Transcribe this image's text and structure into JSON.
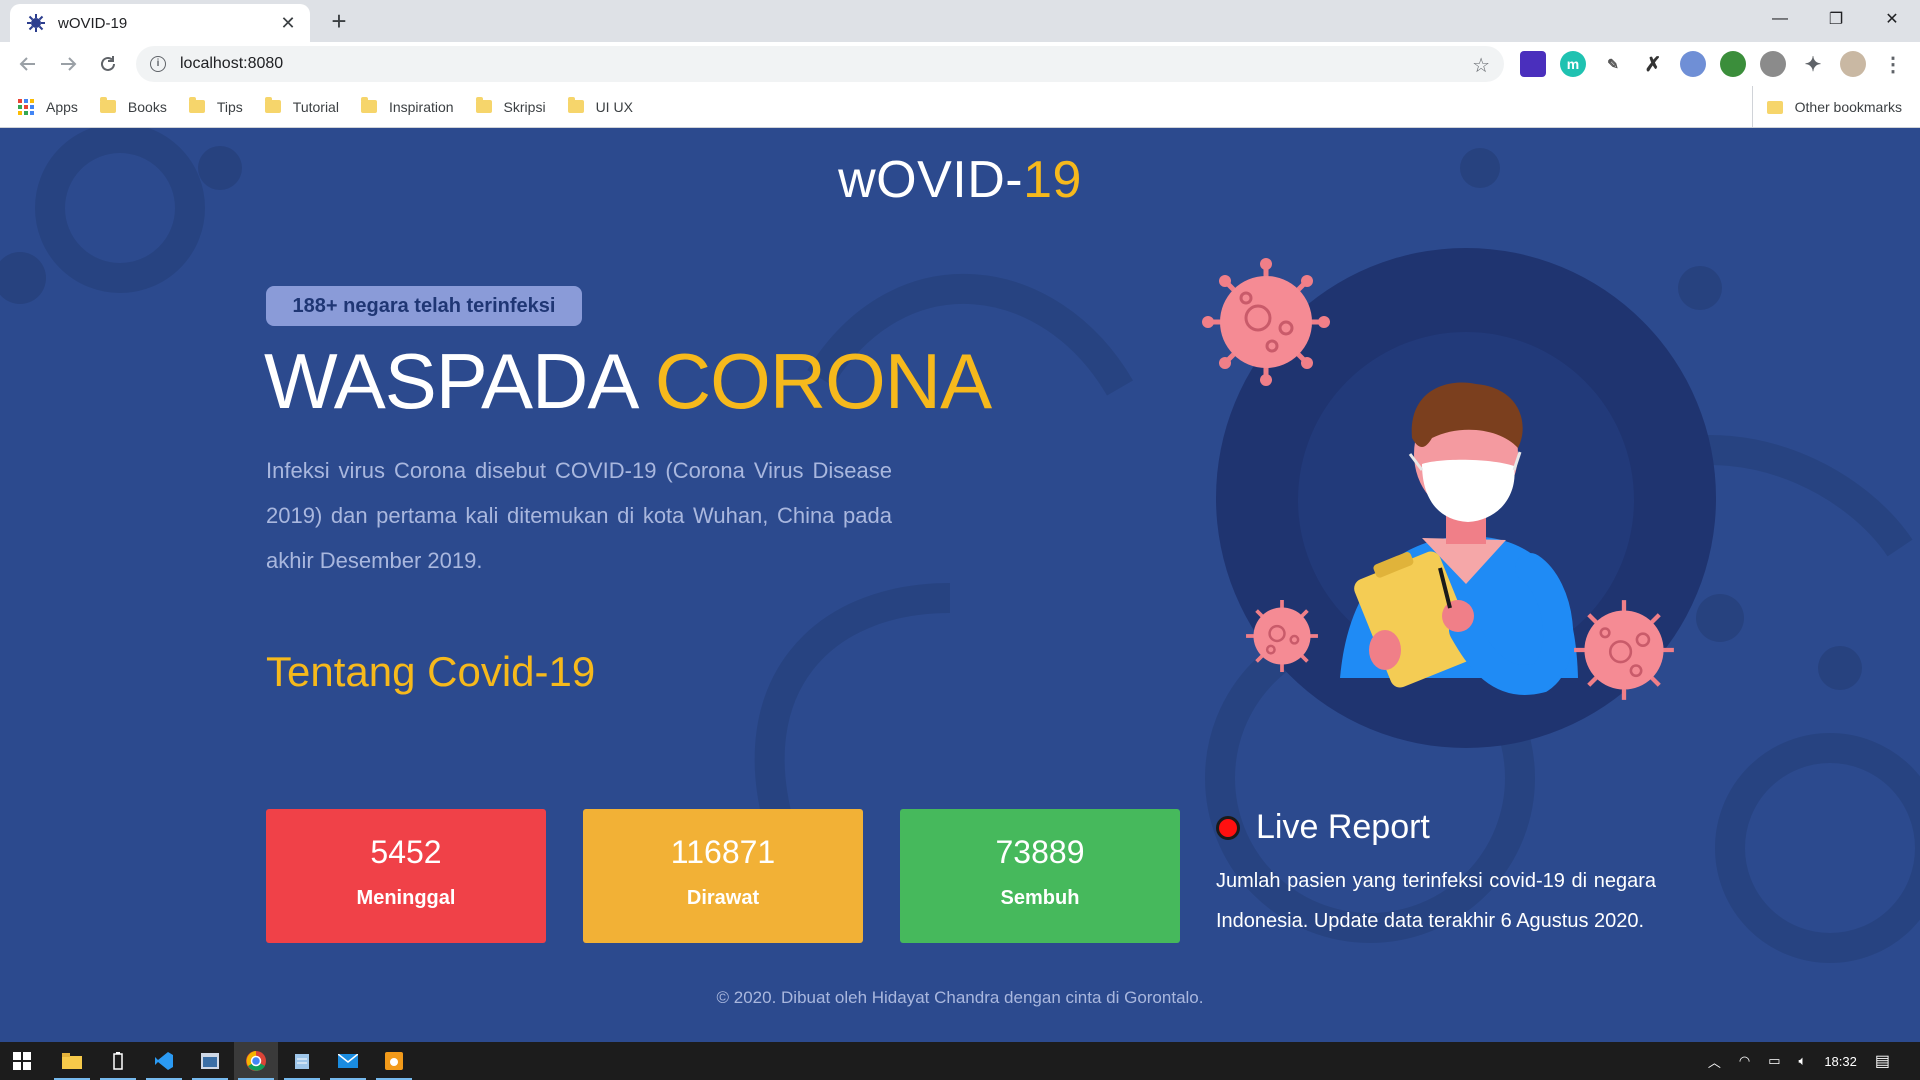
{
  "browser": {
    "tab_title": "wOVID-19",
    "tab_close": "✕",
    "new_tab": "+",
    "url": "localhost:8080",
    "window_controls": {
      "minimize": "—",
      "maximize": "❐",
      "close": "✕"
    }
  },
  "bookmarks": {
    "apps": "Apps",
    "items": [
      "Books",
      "Tips",
      "Tutorial",
      "Inspiration",
      "Skripsi",
      "UI UX"
    ],
    "other": "Other bookmarks"
  },
  "page": {
    "brand_main": "wOVID-",
    "brand_accent": "19",
    "badge": "188+ negara telah terinfeksi",
    "headline_main": "WASPADA ",
    "headline_accent": "CORONA",
    "description": "Infeksi virus Corona disebut COVID-19 (Corona Virus Disease 2019) dan pertama kali ditemukan di kota Wuhan, China pada akhir Desember 2019.",
    "section_title": "Tentang Covid-19",
    "stats": [
      {
        "value": "5452",
        "label": "Meninggal"
      },
      {
        "value": "116871",
        "label": "Dirawat"
      },
      {
        "value": "73889",
        "label": "Sembuh"
      }
    ],
    "live_title": "Live Report",
    "live_desc": "Jumlah pasien yang terinfeksi covid-19 di negara Indonesia. Update data terakhir 6 Agustus 2020.",
    "footer": "© 2020. Dibuat oleh Hidayat Chandra dengan cinta di Gorontalo."
  },
  "colors": {
    "background": "#2c4a8e",
    "accent": "#f6b91c",
    "red": "#f04148",
    "yellow": "#f2b136",
    "green": "#46b95c"
  },
  "taskbar": {
    "time": "18:32"
  }
}
